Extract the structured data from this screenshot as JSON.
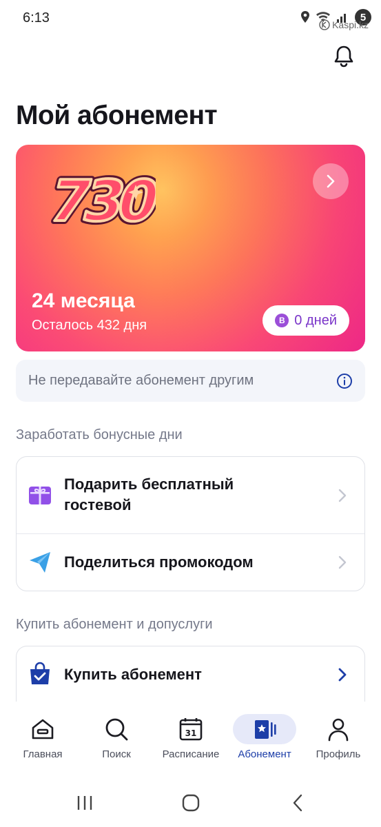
{
  "status_bar": {
    "time": "6:13",
    "notification_count": "5",
    "watermark": "Kaspi.kz"
  },
  "header": {
    "title": "Мой абонемент"
  },
  "membership_card": {
    "logo_text": "730",
    "period": "24 месяца",
    "remaining": "Осталось 432 дня",
    "bonus_badge_letter": "B",
    "bonus_days": "0 дней",
    "gradient_colors": [
      "#ffc460",
      "#ff7d58",
      "#ef2c8c"
    ]
  },
  "notice": {
    "text": "Не передавайте абонемент другим",
    "icon": "info-icon"
  },
  "earn_section": {
    "title": "Заработать бонусные дни",
    "items": [
      {
        "label_line1": "Подарить бесплатный",
        "label_line2": "гостевой",
        "icon": "gift-icon"
      },
      {
        "label": "Поделиться промокодом",
        "icon": "paper-plane-icon"
      }
    ]
  },
  "buy_section": {
    "title": "Купить абонемент и допуслуги",
    "items": [
      {
        "label": "Купить абонемент",
        "icon": "shopping-bag-icon"
      }
    ]
  },
  "bottom_nav": {
    "items": [
      {
        "label": "Главная",
        "icon": "home-icon",
        "active": false
      },
      {
        "label": "Поиск",
        "icon": "search-icon",
        "active": false
      },
      {
        "label": "Расписание",
        "icon": "calendar-icon",
        "calendar_day": "31",
        "active": false
      },
      {
        "label": "Абонемент",
        "icon": "membership-card-icon",
        "active": true
      },
      {
        "label": "Профиль",
        "icon": "profile-icon",
        "active": false
      }
    ]
  },
  "colors": {
    "accent": "#1d3ea8",
    "active_nav_bg": "#e6e9f9",
    "bonus": "#7a35c9"
  }
}
